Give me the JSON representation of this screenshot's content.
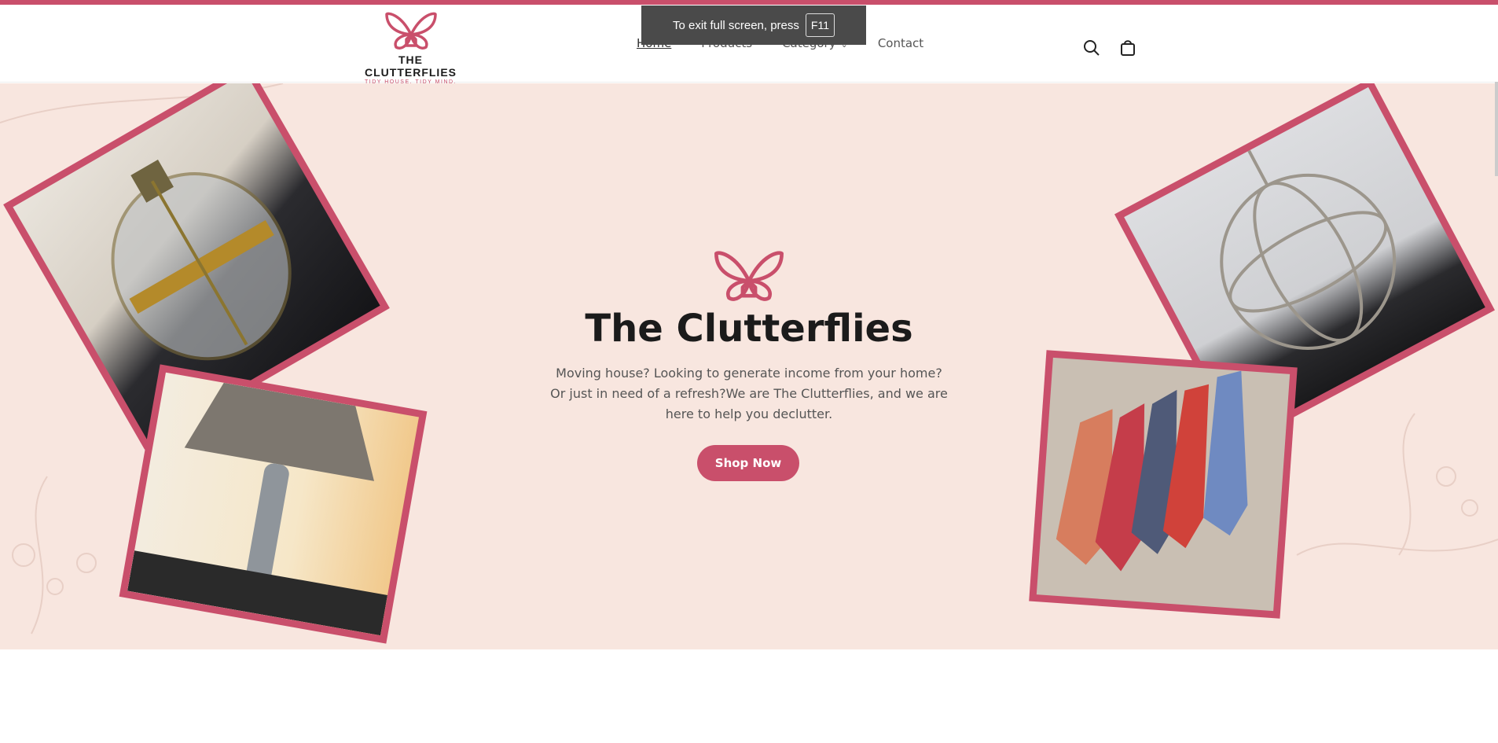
{
  "fullscreen_notice": {
    "text": "To exit full screen, press",
    "key": "F11"
  },
  "brand": {
    "name": "THE CLUTTERFLIES",
    "tagline": "TIDY HOUSE. TIDY MIND.",
    "accent": "#c94f6b"
  },
  "nav": {
    "items": [
      {
        "label": "Home",
        "active": true
      },
      {
        "label": "Products"
      },
      {
        "label": "Category"
      },
      {
        "label": "Contact"
      }
    ]
  },
  "header_icons": {
    "search": "search-icon",
    "cart": "cart-icon"
  },
  "hero": {
    "title": "The Clutterflies",
    "description": "Moving house? Looking to generate income from your home? Or just in need of a refresh?We are The Clutterflies, and we are here to help you declutter.",
    "cta": "Shop Now",
    "background": "#f8e6df",
    "photos": [
      "brass-lantern-photo",
      "table-lamp-photo",
      "chandelier-photo",
      "ties-photo"
    ]
  }
}
